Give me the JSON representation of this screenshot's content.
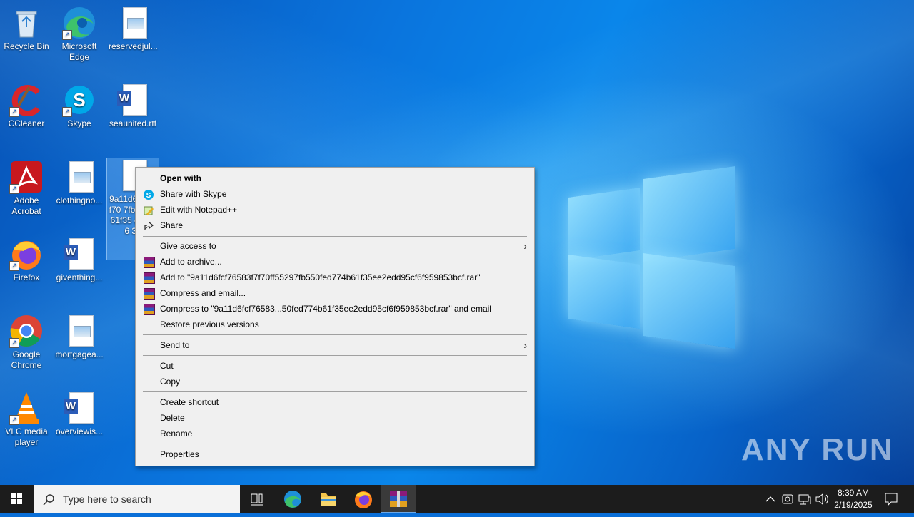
{
  "desktop_icons": [
    {
      "label": "Recycle Bin",
      "icon": "recycle-bin-icon"
    },
    {
      "label": "Microsoft Edge",
      "icon": "edge-icon"
    },
    {
      "label": "reservedjul...",
      "icon": "image-file-icon"
    },
    {
      "label": "CCleaner",
      "icon": "ccleaner-icon"
    },
    {
      "label": "Skype",
      "icon": "skype-icon"
    },
    {
      "label": "seaunited.rtf",
      "icon": "word-file-icon"
    },
    {
      "label": "Adobe Acrobat",
      "icon": "acrobat-icon"
    },
    {
      "label": "clothingno...",
      "icon": "image-file-icon"
    },
    {
      "label": "9a11d6 83f7f70 7fb550 b61f35 d95cf6 3b",
      "icon": "blank-file-icon"
    },
    {
      "label": "Firefox",
      "icon": "firefox-icon"
    },
    {
      "label": "giventhing...",
      "icon": "word-file-icon"
    },
    {
      "label": "Google Chrome",
      "icon": "chrome-icon"
    },
    {
      "label": "mortgagea...",
      "icon": "image-file-icon"
    },
    {
      "label": "VLC media player",
      "icon": "vlc-icon"
    },
    {
      "label": "overviewis...",
      "icon": "word-file-icon"
    }
  ],
  "context_menu": {
    "open_with": "Open with",
    "share_skype": "Share with Skype",
    "edit_notepad": "Edit with Notepad++",
    "share": "Share",
    "give_access": "Give access to",
    "add_archive": "Add to archive...",
    "add_to_rar": "Add to \"9a11d6fcf76583f7f70ff55297fb550fed774b61f35ee2edd95cf6f959853bcf.rar\"",
    "compress_email": "Compress and email...",
    "compress_to_rar_email": "Compress to \"9a11d6fcf76583...50fed774b61f35ee2edd95cf6f959853bcf.rar\" and email",
    "restore_versions": "Restore previous versions",
    "send_to": "Send to",
    "cut": "Cut",
    "copy": "Copy",
    "create_shortcut": "Create shortcut",
    "delete": "Delete",
    "rename": "Rename",
    "properties": "Properties"
  },
  "taskbar": {
    "search_placeholder": "Type here to search",
    "time": "8:39 AM",
    "date": "2/19/2025"
  },
  "watermark": "ANY RUN",
  "colors": {
    "menu_bg": "#f0f0f0",
    "taskbar_bg": "#1c1c1c",
    "desktop_blue": "#0a74dd"
  }
}
